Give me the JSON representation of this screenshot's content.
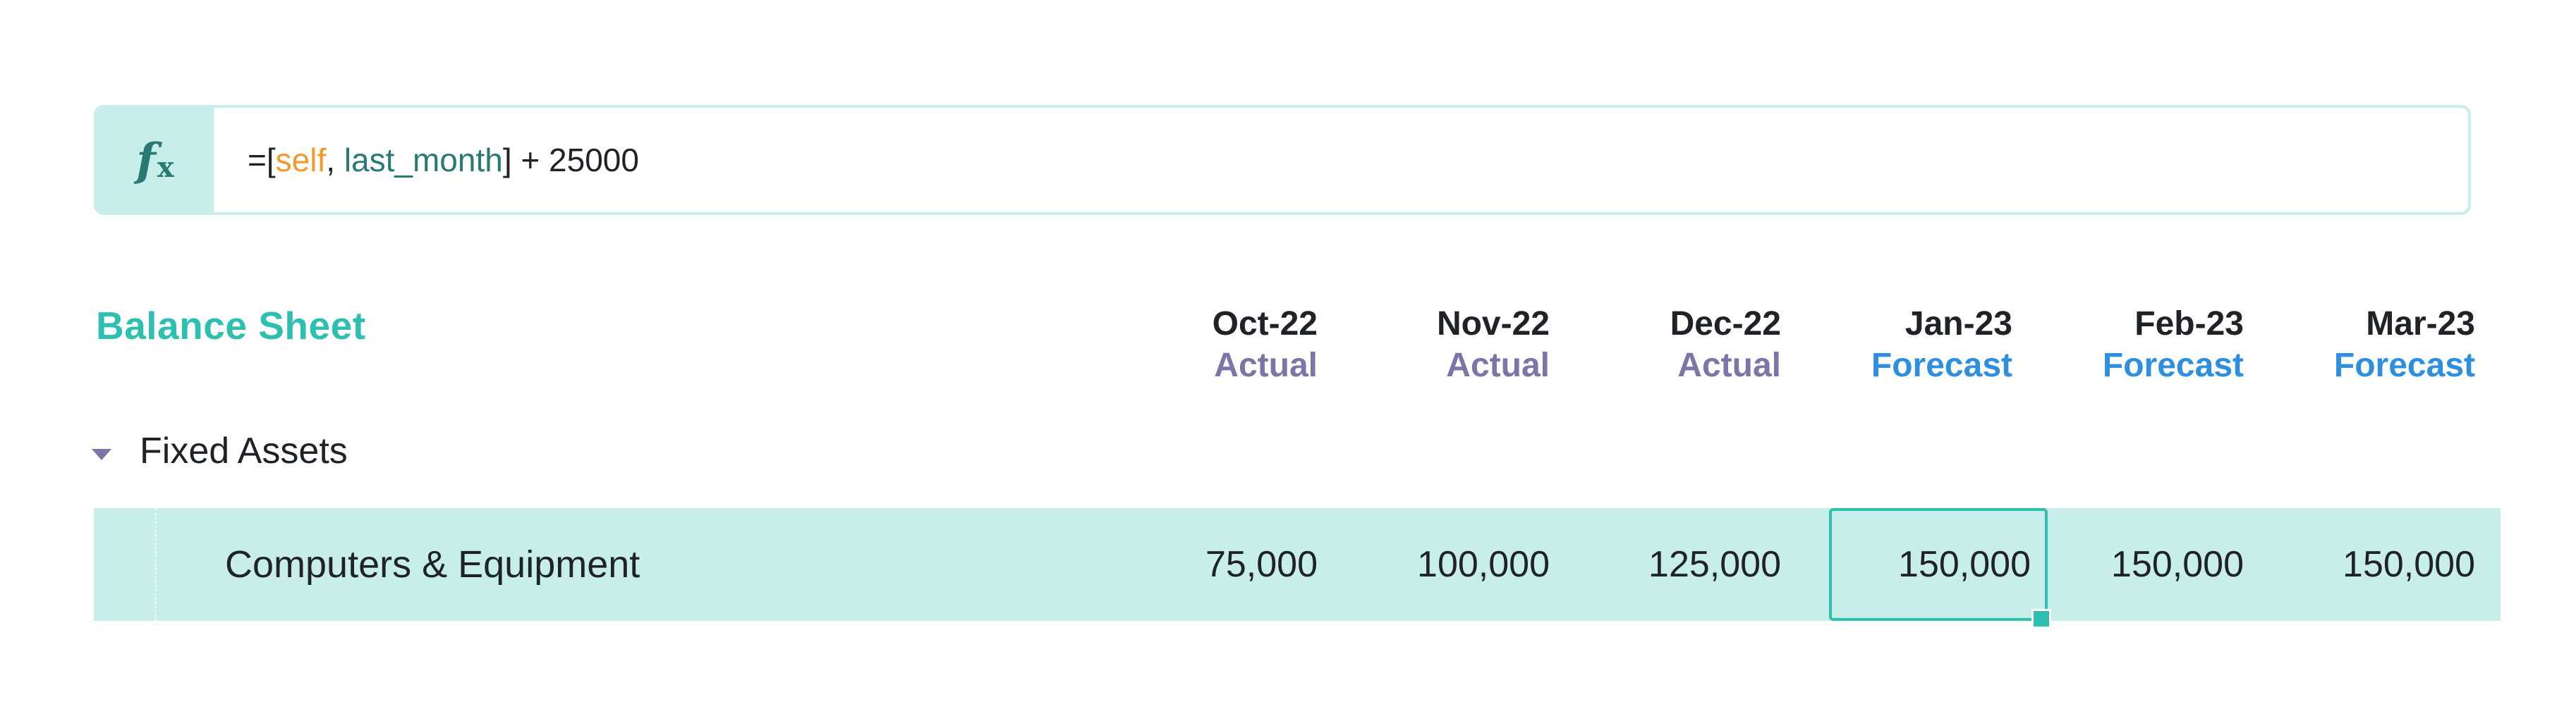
{
  "formula_bar": {
    "fx_icon": "function-icon",
    "tokens": [
      {
        "text": "=[",
        "kind": "plain"
      },
      {
        "text": "self",
        "kind": "self"
      },
      {
        "text": ", ",
        "kind": "plain"
      },
      {
        "text": "last_month",
        "kind": "ref"
      },
      {
        "text": "] + 25000",
        "kind": "plain"
      }
    ]
  },
  "sheet": {
    "title": "Balance Sheet",
    "columns": [
      {
        "period": "Oct-22",
        "kind": "Actual",
        "type": "actual"
      },
      {
        "period": "Nov-22",
        "kind": "Actual",
        "type": "actual"
      },
      {
        "period": "Dec-22",
        "kind": "Actual",
        "type": "actual"
      },
      {
        "period": "Jan-23",
        "kind": "Forecast",
        "type": "forecast"
      },
      {
        "period": "Feb-23",
        "kind": "Forecast",
        "type": "forecast"
      },
      {
        "period": "Mar-23",
        "kind": "Forecast",
        "type": "forecast"
      }
    ],
    "section": {
      "label": "Fixed Assets",
      "toggle_icon": "caret-down-icon"
    },
    "row": {
      "label": "Computers & Equipment",
      "values": [
        "75,000",
        "100,000",
        "125,000",
        "150,000",
        "150,000",
        "150,000"
      ],
      "selected_index": 3
    }
  },
  "colors": {
    "accent": "#2dbfb0",
    "row_highlight": "#c7eeeb",
    "actual": "#7b75a8",
    "forecast": "#2e8fe0",
    "self_token": "#f19a2f",
    "ref_token": "#2a7a74"
  }
}
